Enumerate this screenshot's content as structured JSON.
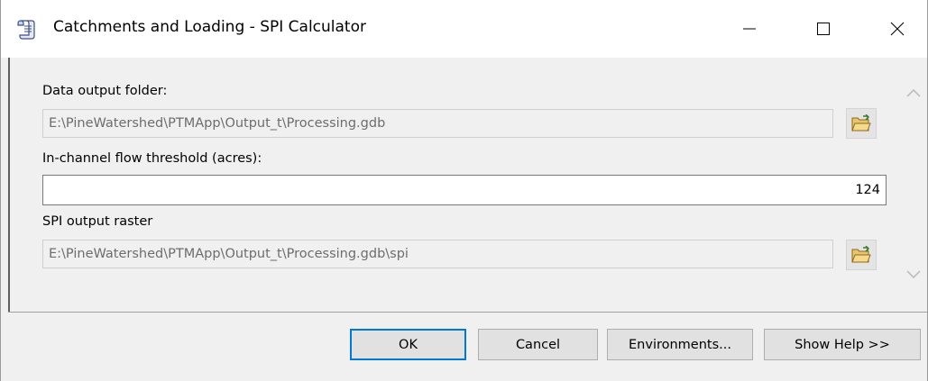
{
  "window": {
    "title": "Catchments and Loading - SPI Calculator",
    "icon": "script-tool-icon",
    "controls": {
      "minimize": "minimize-icon",
      "maximize": "maximize-icon",
      "close": "close-icon"
    }
  },
  "form": {
    "data_output_folder": {
      "label": "Data output folder:",
      "value": "E:\\PineWatershed\\PTMApp\\Output_t\\Processing.gdb",
      "browse_icon": "folder-open-icon"
    },
    "flow_threshold": {
      "label": "In-channel flow threshold (acres):",
      "value": "124"
    },
    "spi_output_raster": {
      "label": "SPI output raster",
      "value": "E:\\PineWatershed\\PTMApp\\Output_t\\Processing.gdb\\spi",
      "browse_icon": "folder-open-icon"
    }
  },
  "buttons": {
    "ok": "OK",
    "cancel": "Cancel",
    "environments": "Environments...",
    "show_help": "Show Help >>"
  },
  "colors": {
    "accent": "#0078d7",
    "disabled_text": "#6d6d6d",
    "face": "#f0f0f0"
  }
}
